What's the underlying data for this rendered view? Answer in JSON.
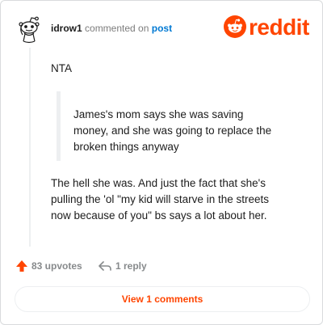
{
  "comment": {
    "username": "idrow1",
    "action_text": "commented on",
    "post_link": "post",
    "brand": "reddit",
    "body": {
      "line1": "NTA",
      "quote": {
        "line1": "James's mom says she was saving",
        "line2": "money, and she was going to replace the",
        "line3": "broken things anyway"
      },
      "para2": {
        "line1": "The hell she was. And just the fact that she's",
        "line2": "pulling the 'ol \"my kid will starve in the streets",
        "line3": "now because of you\" bs says a lot about her."
      }
    },
    "upvotes_label": "83 upvotes",
    "reply_label": "1 reply",
    "view_button": "View 1 comments"
  },
  "colors": {
    "brand_orange": "#ff4500",
    "link_blue": "#0079d3",
    "meta_gray": "#878a8c"
  },
  "icons": [
    "avatar-icon",
    "reddit-snoo-icon",
    "upvote-arrow-icon",
    "reply-arrow-icon"
  ]
}
